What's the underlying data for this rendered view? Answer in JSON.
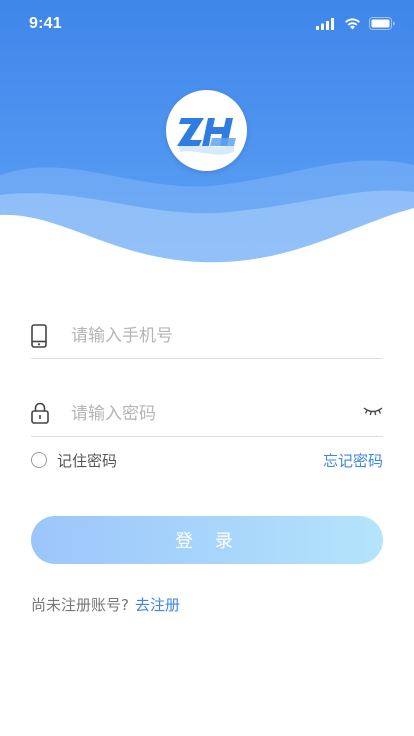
{
  "status_bar": {
    "time": "9:41",
    "icons": [
      "signal-icon",
      "wifi-icon",
      "battery-icon"
    ]
  },
  "header": {
    "logo_icon": "zh-logo-icon",
    "colors": {
      "top": "#3f86ea",
      "bottom": "#63a5f5"
    }
  },
  "form": {
    "phone": {
      "placeholder": "请输入手机号",
      "icon": "phone-icon"
    },
    "password": {
      "placeholder": "请输入密码",
      "icon": "lock-icon",
      "toggle_icon": "eye-closed-icon"
    },
    "remember_label": "记住密码",
    "forgot_label": "忘记密码",
    "login_label": "登 录",
    "register_prompt": "尚未注册账号?",
    "register_link": "去注册"
  },
  "colors": {
    "accent": "#3d86e8",
    "button_gradient_start": "#9cc6fb",
    "button_gradient_end": "#b4e4fb"
  }
}
